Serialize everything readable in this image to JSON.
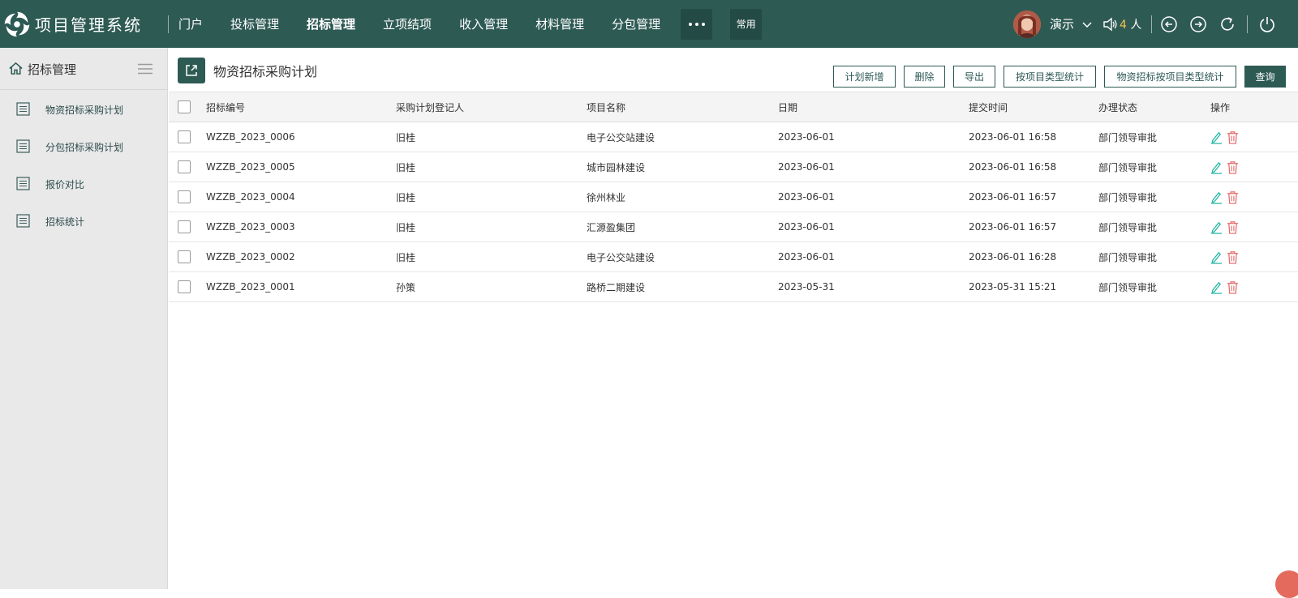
{
  "app": {
    "title": "项目管理系统"
  },
  "nav": {
    "items": [
      {
        "label": "门户"
      },
      {
        "label": "投标管理"
      },
      {
        "label": "招标管理"
      },
      {
        "label": "立项结项"
      },
      {
        "label": "收入管理"
      },
      {
        "label": "材料管理"
      },
      {
        "label": "分包管理"
      }
    ],
    "active_index": 2,
    "common_label": "常用"
  },
  "user": {
    "name": "演示",
    "online_count": "4",
    "online_unit": "人"
  },
  "sidebar": {
    "header": "招标管理",
    "items": [
      {
        "label": "物资招标采购计划"
      },
      {
        "label": "分包招标采购计划"
      },
      {
        "label": "报价对比"
      },
      {
        "label": "招标统计"
      }
    ]
  },
  "page": {
    "title": "物资招标采购计划",
    "buttons": {
      "add": "计划新增",
      "delete": "删除",
      "export": "导出",
      "stat_by_type": "按项目类型统计",
      "stat_material_by_type": "物资招标按项目类型统计",
      "query": "查询"
    }
  },
  "table": {
    "columns": [
      "招标编号",
      "采购计划登记人",
      "项目名称",
      "日期",
      "提交时间",
      "办理状态",
      "操作"
    ],
    "rows": [
      {
        "code": "WZZB_2023_0006",
        "registrant": "旧桂",
        "project": "电子公交站建设",
        "date": "2023-06-01",
        "submitted": "2023-06-01 16:58",
        "status": "部门领导审批"
      },
      {
        "code": "WZZB_2023_0005",
        "registrant": "旧桂",
        "project": "城市园林建设",
        "date": "2023-06-01",
        "submitted": "2023-06-01 16:58",
        "status": "部门领导审批"
      },
      {
        "code": "WZZB_2023_0004",
        "registrant": "旧桂",
        "project": "徐州林业",
        "date": "2023-06-01",
        "submitted": "2023-06-01 16:57",
        "status": "部门领导审批"
      },
      {
        "code": "WZZB_2023_0003",
        "registrant": "旧桂",
        "project": "汇源盈集团",
        "date": "2023-06-01",
        "submitted": "2023-06-01 16:57",
        "status": "部门领导审批"
      },
      {
        "code": "WZZB_2023_0002",
        "registrant": "旧桂",
        "project": "电子公交站建设",
        "date": "2023-06-01",
        "submitted": "2023-06-01 16:28",
        "status": "部门领导审批"
      },
      {
        "code": "WZZB_2023_0001",
        "registrant": "孙策",
        "project": "路桥二期建设",
        "date": "2023-05-31",
        "submitted": "2023-05-31 15:21",
        "status": "部门领导审批"
      }
    ]
  },
  "icons": {
    "logo": "spiral-logo-icon",
    "more": "more-dots-icon",
    "speaker": "speaker-icon",
    "back": "arrow-left-circle-icon",
    "forward": "arrow-right-circle-icon",
    "refresh": "refresh-icon",
    "power": "power-icon",
    "home": "home-icon",
    "menu": "hamburger-menu-icon",
    "doc": "document-list-icon",
    "open": "external-link-icon",
    "edit": "pencil-icon",
    "trash": "trash-icon"
  },
  "colors": {
    "primary": "#2e5a54",
    "edit": "#1fb5a0",
    "delete": "#e46a6a",
    "highlight": "#f2c14e"
  }
}
